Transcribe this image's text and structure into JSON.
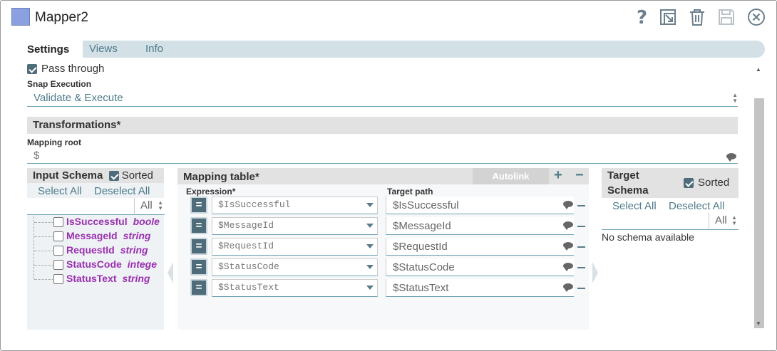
{
  "window": {
    "title": "Mapper2"
  },
  "toolbar": {
    "help_icon": "help-icon",
    "export_icon": "export-icon",
    "delete_icon": "trash-icon",
    "save_icon": "save-icon",
    "close_icon": "close-icon"
  },
  "tabs": [
    {
      "label": "Settings",
      "active": true
    },
    {
      "label": "Views",
      "active": false
    },
    {
      "label": "Info",
      "active": false
    }
  ],
  "settings": {
    "pass_through_label": "Pass through",
    "pass_through_checked": true,
    "snap_execution_label": "Snap Execution",
    "snap_execution_value": "Validate & Execute",
    "transformations_label": "Transformations*",
    "mapping_root_label": "Mapping root",
    "mapping_root_value": "$"
  },
  "input_schema": {
    "title": "Input Schema",
    "sorted_label": "Sorted",
    "sorted_checked": true,
    "select_all": "Select All",
    "deselect_all": "Deselect All",
    "filter_value": "All",
    "items": [
      {
        "name": "IsSuccessful",
        "type": "boole"
      },
      {
        "name": "MessageId",
        "type": "string"
      },
      {
        "name": "RequestId",
        "type": "string"
      },
      {
        "name": "StatusCode",
        "type": "intege"
      },
      {
        "name": "StatusText",
        "type": "string"
      }
    ]
  },
  "mapping_table": {
    "title": "Mapping table*",
    "autolink_label": "Autolink",
    "add_label": "+",
    "remove_label": "−",
    "expression_header": "Expression*",
    "target_header": "Target path",
    "eq_label": "=",
    "rows": [
      {
        "expression": "$IsSuccessful",
        "target": "$IsSuccessful"
      },
      {
        "expression": "$MessageId",
        "target": "$MessageId"
      },
      {
        "expression": "$RequestId",
        "target": "$RequestId"
      },
      {
        "expression": "$StatusCode",
        "target": "$StatusCode"
      },
      {
        "expression": "$StatusText",
        "target": "$StatusText"
      }
    ]
  },
  "target_schema": {
    "title_line1": "Target",
    "title_line2": "Schema",
    "sorted_label": "Sorted",
    "sorted_checked": true,
    "select_all": "Select All",
    "deselect_all": "Deselect All",
    "filter_value": "All",
    "empty_text": "No schema available"
  },
  "colors": {
    "accent": "#4e7b8a",
    "field_underline": "#6fa2b3",
    "schema_field": "#9b2fae",
    "button_dark": "#4f6c7a"
  }
}
